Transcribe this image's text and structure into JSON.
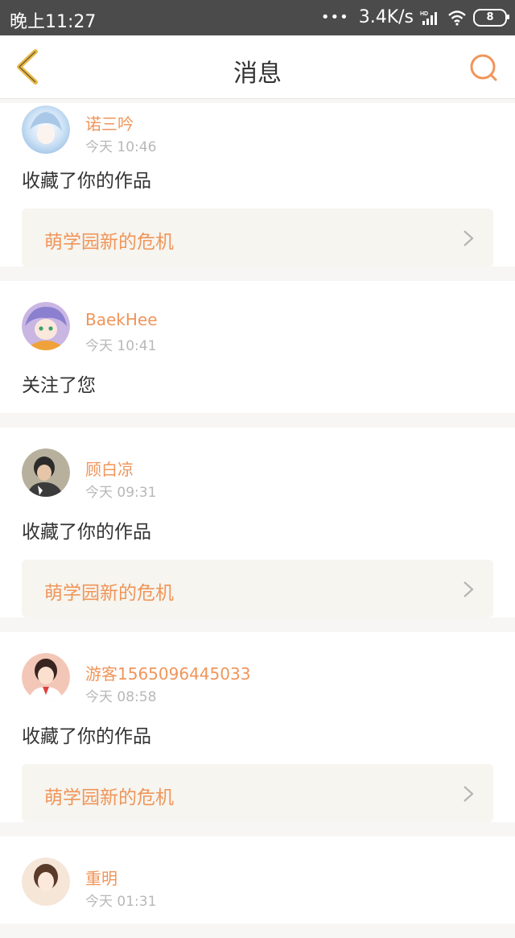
{
  "status_bar": {
    "time": "晚上11:27",
    "dots": "•••",
    "speed": "3.4K/s",
    "battery": "8"
  },
  "nav": {
    "title": "消息",
    "back_icon": "chevron-left-icon",
    "search_icon": "search-icon"
  },
  "colors": {
    "accent": "#f0955a",
    "nav_back": "#e6b94a",
    "card_bg": "#ffffff",
    "work_bg": "#f6f5ef"
  },
  "messages": [
    {
      "user": "诺三吟",
      "time": "今天 10:46",
      "action": "收藏了你的作品",
      "work": "萌学园新的危机"
    },
    {
      "user": "BaekHee",
      "time": "今天 10:41",
      "action": "关注了您"
    },
    {
      "user": "顾白凉",
      "time": "今天 09:31",
      "action": "收藏了你的作品",
      "work": "萌学园新的危机"
    },
    {
      "user": "游客1565096445033",
      "time": "今天 08:58",
      "action": "收藏了你的作品",
      "work": "萌学园新的危机"
    },
    {
      "user": "重明",
      "time": "今天 01:31"
    }
  ]
}
